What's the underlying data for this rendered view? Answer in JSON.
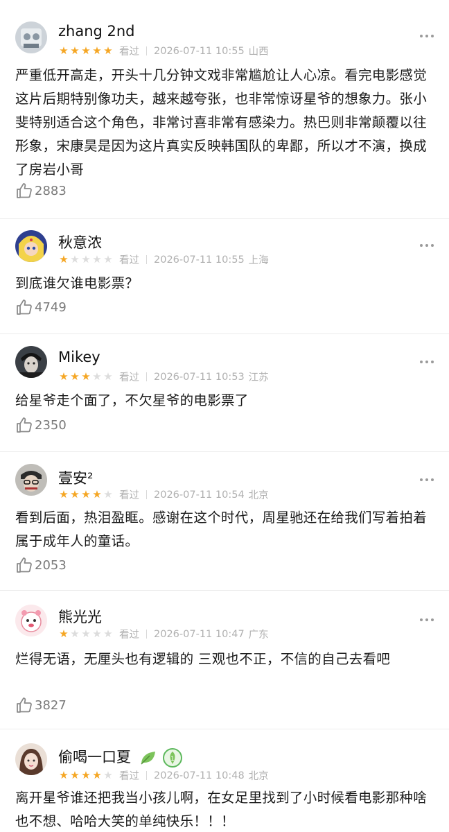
{
  "watched_label": "看过",
  "colors": {
    "star": "#f5a623",
    "star_off": "#dcdcdc",
    "meta": "#b0b0b0",
    "leaf": "#7cc35b",
    "badge": "#5cb85c"
  },
  "reviews": [
    {
      "user": "zhang 2nd",
      "rating": 5,
      "date": "2026-07-11 10:55",
      "location": "山西",
      "text": "严重低开高走，开头十几分钟文戏非常尴尬让人心凉。看完电影感觉这片后期特别像功夫，越来越夸张，也非常惊讶星爷的想象力。张小斐特别适合这个角色，非常讨喜非常有感染力。热巴则非常颠覆以往形象，宋康昊是因为这片真实反映韩国队的卑鄙，所以才不演，换成了房岩小哥",
      "likes": "2883"
    },
    {
      "user": "秋意浓",
      "rating": 1,
      "date": "2026-07-11 10:55",
      "location": "上海",
      "text": "到底谁欠谁电影票？",
      "likes": "4749"
    },
    {
      "user": "Mikey",
      "rating": 3,
      "date": "2026-07-11 10:53",
      "location": "江苏",
      "text": "给星爷走个面了，不欠星爷的电影票了",
      "likes": "2350"
    },
    {
      "user": "壹安²",
      "rating": 4,
      "date": "2026-07-11 10:54",
      "location": "北京",
      "text": "看到后面，热泪盈眶。感谢在这个时代，周星驰还在给我们写着拍着属于成年人的童话。",
      "likes": "2053"
    },
    {
      "user": "熊光光",
      "rating": 1,
      "date": "2026-07-11 10:47",
      "location": "广东",
      "text": "烂得无语，无厘头也有逻辑的 三观也不正，不信的自己去看吧",
      "likes": "3827"
    },
    {
      "user": "偷喝一口夏",
      "rating": 4,
      "date": "2026-07-11 10:48",
      "location": "北京",
      "text": "离开星爷谁还把我当小孩儿啊，在女足里找到了小时候看电影那种啥也不想、哈哈大笑的单纯快乐！！！",
      "likes": ""
    }
  ]
}
